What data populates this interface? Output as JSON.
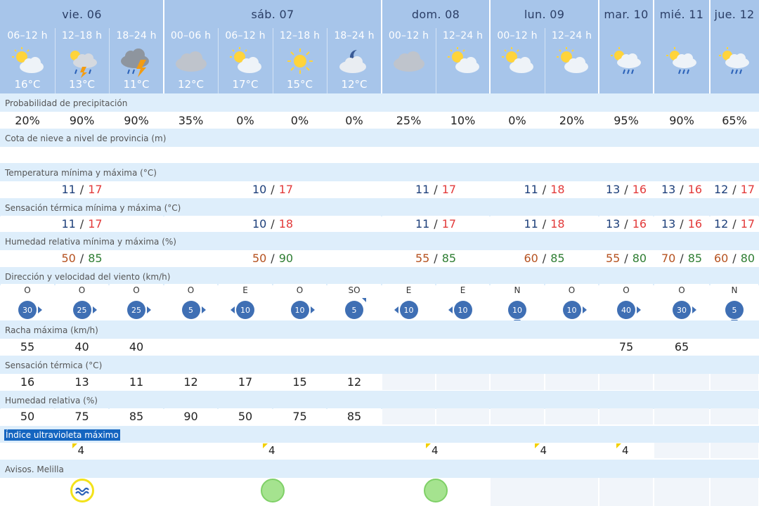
{
  "days": [
    {
      "label": "vie. 06"
    },
    {
      "label": "sáb. 07"
    },
    {
      "label": "dom. 08"
    },
    {
      "label": "lun. 09"
    },
    {
      "label": "mar. 10"
    },
    {
      "label": "mié. 11"
    },
    {
      "label": "jue. 12"
    }
  ],
  "slots": [
    {
      "label": "06–12 h",
      "icon": "sun-cloud-icon",
      "temp": "16°C"
    },
    {
      "label": "12–18 h",
      "icon": "sun-cloud-storm-icon",
      "temp": "13°C"
    },
    {
      "label": "18–24 h",
      "icon": "storm-cloud-icon",
      "temp": "11°C"
    },
    {
      "label": "00–06 h",
      "icon": "cloud-icon",
      "temp": "12°C"
    },
    {
      "label": "06–12 h",
      "icon": "sun-cloud-icon",
      "temp": "17°C"
    },
    {
      "label": "12–18 h",
      "icon": "sun-icon",
      "temp": "15°C"
    },
    {
      "label": "18–24 h",
      "icon": "moon-cloud-icon",
      "temp": "12°C"
    },
    {
      "label": "00–12 h",
      "icon": "cloud-icon",
      "temp": ""
    },
    {
      "label": "12–24 h",
      "icon": "sun-cloud-icon",
      "temp": ""
    },
    {
      "label": "00–12 h",
      "icon": "sun-cloud-icon",
      "temp": ""
    },
    {
      "label": "12–24 h",
      "icon": "sun-cloud-icon",
      "temp": ""
    },
    {
      "label": "",
      "icon": "sun-cloud-rain-icon",
      "temp": ""
    },
    {
      "label": "",
      "icon": "sun-cloud-rain-icon",
      "temp": ""
    },
    {
      "label": "",
      "icon": "sun-cloud-rain-icon",
      "temp": ""
    }
  ],
  "sections": {
    "precip": "Probabilidad de precipitación",
    "snow": "Cota de nieve a nivel de provincia (m)",
    "temp": "Temperatura mínima y máxima (°C)",
    "feels": "Sensación térmica mínima y máxima (°C)",
    "hum": "Humedad relativa mínima y máxima (%)",
    "wind": "Dirección y velocidad del viento (km/h)",
    "gust": "Racha máxima (km/h)",
    "feelt": "Sensación térmica (°C)",
    "humr": "Humedad relativa (%)",
    "uv": "Índice ultravioleta máximo",
    "alerts": "Avisos. Melilla"
  },
  "precip": [
    "20%",
    "90%",
    "90%",
    "35%",
    "0%",
    "0%",
    "0%",
    "25%",
    "10%",
    "0%",
    "20%",
    "95%",
    "90%",
    "65%"
  ],
  "temp_minmax": [
    {
      "lo": "11",
      "hi": "17"
    },
    {
      "lo": "10",
      "hi": "17"
    },
    {
      "lo": "11",
      "hi": "17"
    },
    {
      "lo": "11",
      "hi": "18"
    },
    {
      "lo": "13",
      "hi": "16"
    },
    {
      "lo": "13",
      "hi": "16"
    },
    {
      "lo": "12",
      "hi": "17"
    }
  ],
  "feels_minmax": [
    {
      "lo": "11",
      "hi": "17"
    },
    {
      "lo": "10",
      "hi": "18"
    },
    {
      "lo": "11",
      "hi": "17"
    },
    {
      "lo": "11",
      "hi": "18"
    },
    {
      "lo": "13",
      "hi": "16"
    },
    {
      "lo": "13",
      "hi": "16"
    },
    {
      "lo": "12",
      "hi": "17"
    }
  ],
  "hum_minmax": [
    {
      "lo": "50",
      "hi": "85"
    },
    {
      "lo": "50",
      "hi": "90"
    },
    {
      "lo": "55",
      "hi": "85"
    },
    {
      "lo": "60",
      "hi": "85"
    },
    {
      "lo": "55",
      "hi": "80"
    },
    {
      "lo": "70",
      "hi": "85"
    },
    {
      "lo": "60",
      "hi": "80"
    }
  ],
  "wind": [
    {
      "dir": "O",
      "speed": "30"
    },
    {
      "dir": "O",
      "speed": "25"
    },
    {
      "dir": "O",
      "speed": "25"
    },
    {
      "dir": "O",
      "speed": "5"
    },
    {
      "dir": "E",
      "speed": "10"
    },
    {
      "dir": "O",
      "speed": "10"
    },
    {
      "dir": "SO",
      "speed": "5"
    },
    {
      "dir": "E",
      "speed": "10"
    },
    {
      "dir": "E",
      "speed": "10"
    },
    {
      "dir": "N",
      "speed": "10"
    },
    {
      "dir": "O",
      "speed": "10"
    },
    {
      "dir": "O",
      "speed": "40"
    },
    {
      "dir": "O",
      "speed": "30"
    },
    {
      "dir": "N",
      "speed": "5"
    }
  ],
  "gust": [
    "55",
    "40",
    "40",
    "",
    "",
    "",
    "",
    "",
    "",
    "",
    "",
    "75",
    "65",
    ""
  ],
  "feelt": [
    "16",
    "13",
    "11",
    "12",
    "17",
    "15",
    "12"
  ],
  "humr": [
    "50",
    "75",
    "85",
    "90",
    "50",
    "75",
    "85"
  ],
  "uv": [
    "4",
    "4",
    "4",
    "4",
    "4"
  ],
  "colors": {
    "header": "#a7c5ea",
    "band": "#deeefb",
    "min": "#1d3f7a",
    "max": "#e23a3a",
    "alert_yellow": "#f3e21a",
    "alert_green": "#a5e38f"
  }
}
